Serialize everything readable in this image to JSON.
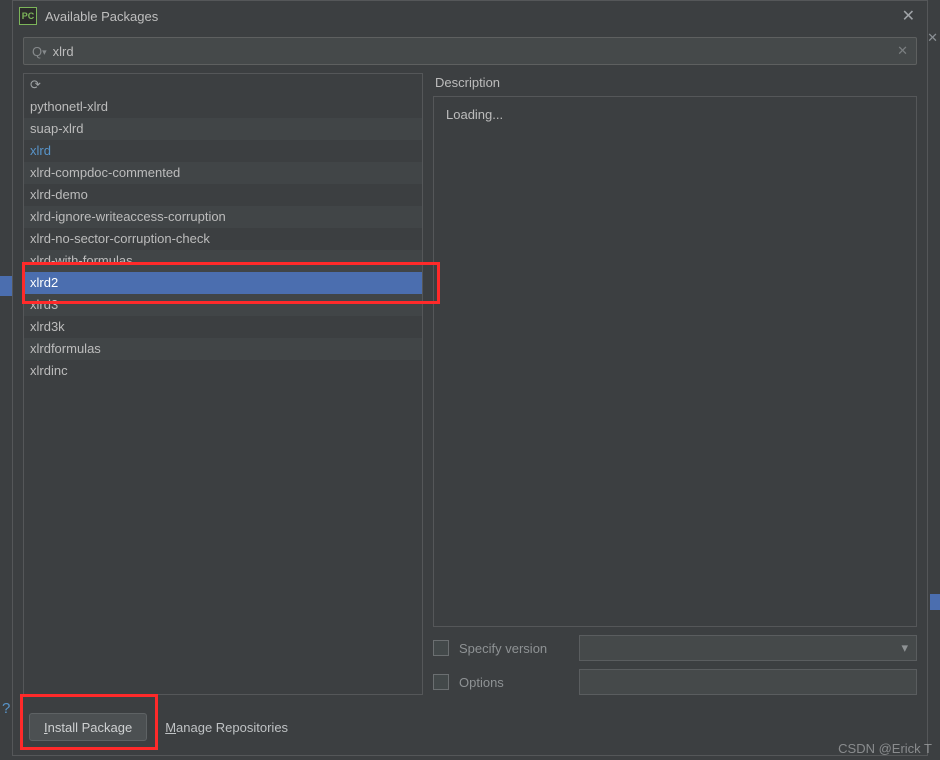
{
  "window": {
    "title": "Available Packages",
    "icon_label": "PC"
  },
  "search": {
    "value": "xlrd",
    "placeholder": ""
  },
  "packages": [
    {
      "name": "pythonetl-xlrd",
      "selected": false,
      "match": false
    },
    {
      "name": "suap-xlrd",
      "selected": false,
      "match": false
    },
    {
      "name": "xlrd",
      "selected": false,
      "match": true
    },
    {
      "name": "xlrd-compdoc-commented",
      "selected": false,
      "match": false
    },
    {
      "name": "xlrd-demo",
      "selected": false,
      "match": false
    },
    {
      "name": "xlrd-ignore-writeaccess-corruption",
      "selected": false,
      "match": false
    },
    {
      "name": "xlrd-no-sector-corruption-check",
      "selected": false,
      "match": false
    },
    {
      "name": "xlrd-with-formulas",
      "selected": false,
      "match": false
    },
    {
      "name": "xlrd2",
      "selected": true,
      "match": false
    },
    {
      "name": "xlrd3",
      "selected": false,
      "match": false
    },
    {
      "name": "xlrd3k",
      "selected": false,
      "match": false
    },
    {
      "name": "xlrdformulas",
      "selected": false,
      "match": false
    },
    {
      "name": "xlrdinc",
      "selected": false,
      "match": false
    }
  ],
  "description": {
    "label": "Description",
    "content": "Loading..."
  },
  "options": {
    "specify_version_label": "Specify version",
    "specify_version_checked": false,
    "specify_version_value": "",
    "options_label": "Options",
    "options_checked": false,
    "options_value": ""
  },
  "footer": {
    "install_label": "Install Package",
    "install_underline": "I",
    "install_rest": "nstall Package",
    "manage_label": "Manage Repositories",
    "manage_underline": "M",
    "manage_rest": "anage Repositories"
  },
  "watermark": "CSDN @Erick T",
  "icons": {
    "search": "⌕",
    "clear": "✕",
    "close": "✕",
    "refresh": "⟳",
    "dropdown": "▾"
  }
}
